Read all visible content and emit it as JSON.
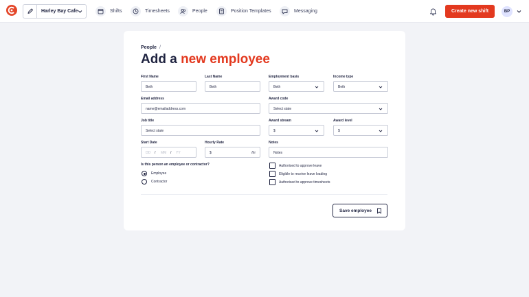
{
  "topbar": {
    "business_name": "Harley Bay Cafe",
    "nav": [
      {
        "label": "Shifts",
        "icon": "calendar-icon"
      },
      {
        "label": "Timesheets",
        "icon": "clock-icon"
      },
      {
        "label": "People",
        "icon": "people-icon"
      },
      {
        "label": "Position Templates",
        "icon": "template-icon"
      },
      {
        "label": "Messaging",
        "icon": "chat-icon"
      }
    ],
    "create_shift_label": "Create new shift",
    "avatar_initials": "BP"
  },
  "page": {
    "breadcrumb": "People",
    "breadcrumb_sep": "/",
    "title_prefix": "Add a",
    "title_accent": "new employee"
  },
  "form": {
    "first_name": {
      "label": "First Name",
      "value": "Beth"
    },
    "last_name": {
      "label": "Last Name",
      "value": "Beth"
    },
    "employment_basis": {
      "label": "Employment basis",
      "value": "Beth"
    },
    "income_type": {
      "label": "Income type",
      "value": "Beth"
    },
    "email": {
      "label": "Email address",
      "value": "name@emailaddress.com"
    },
    "award_code": {
      "label": "Award code",
      "value": "Select state"
    },
    "job_title": {
      "label": "Job title",
      "value": "Select state"
    },
    "award_stream": {
      "label": "Award stream",
      "value": "$"
    },
    "award_level": {
      "label": "Award level",
      "value": "$"
    },
    "start_date": {
      "label": "Start Date",
      "dd": "DD",
      "mm": "MM",
      "yy": "YY",
      "sep": "/"
    },
    "hourly_rate": {
      "label": "Hourly Rate",
      "prefix": "$",
      "suffix": "/hr"
    },
    "notes": {
      "label": "Notes",
      "placeholder": "Notes"
    },
    "person_type": {
      "question": "Is this person an employee or contractor?",
      "options": [
        {
          "label": "Employee",
          "selected": true
        },
        {
          "label": "Contractor",
          "selected": false
        }
      ]
    },
    "permissions": [
      {
        "label": "Authorised to approve leave",
        "checked": false
      },
      {
        "label": "Eligible to receive leave loading",
        "checked": false
      },
      {
        "label": "Authorised to approve timesheets",
        "checked": false
      }
    ],
    "save_label": "Save employee"
  },
  "colors": {
    "accent": "#e3391f",
    "text": "#1f2340",
    "background": "#f2f3f7"
  }
}
